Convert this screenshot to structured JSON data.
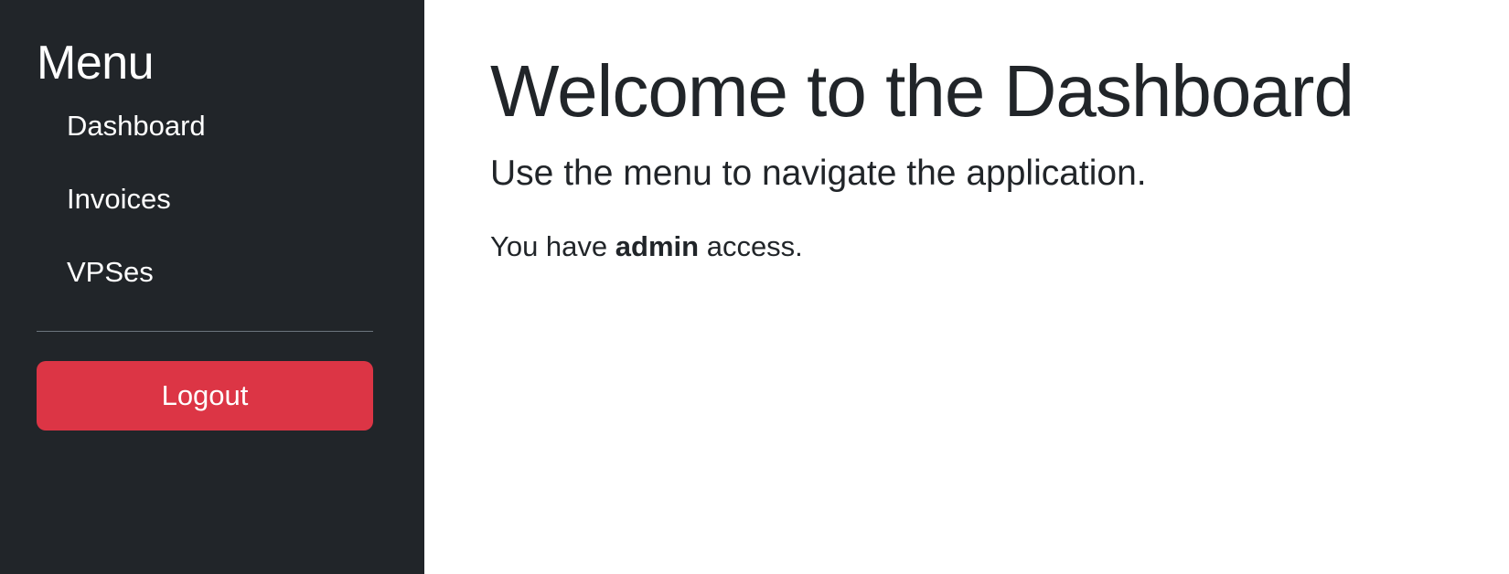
{
  "sidebar": {
    "title": "Menu",
    "items": [
      {
        "label": "Dashboard"
      },
      {
        "label": "Invoices"
      },
      {
        "label": "VPSes"
      }
    ],
    "logout_label": "Logout"
  },
  "main": {
    "title": "Welcome to the Dashboard",
    "lead": "Use the menu to navigate the application.",
    "access_prefix": "You have",
    "access_role": "admin",
    "access_suffix": "access."
  },
  "colors": {
    "sidebar_bg": "#212529",
    "logout_bg": "#dc3545",
    "text": "#212529"
  }
}
